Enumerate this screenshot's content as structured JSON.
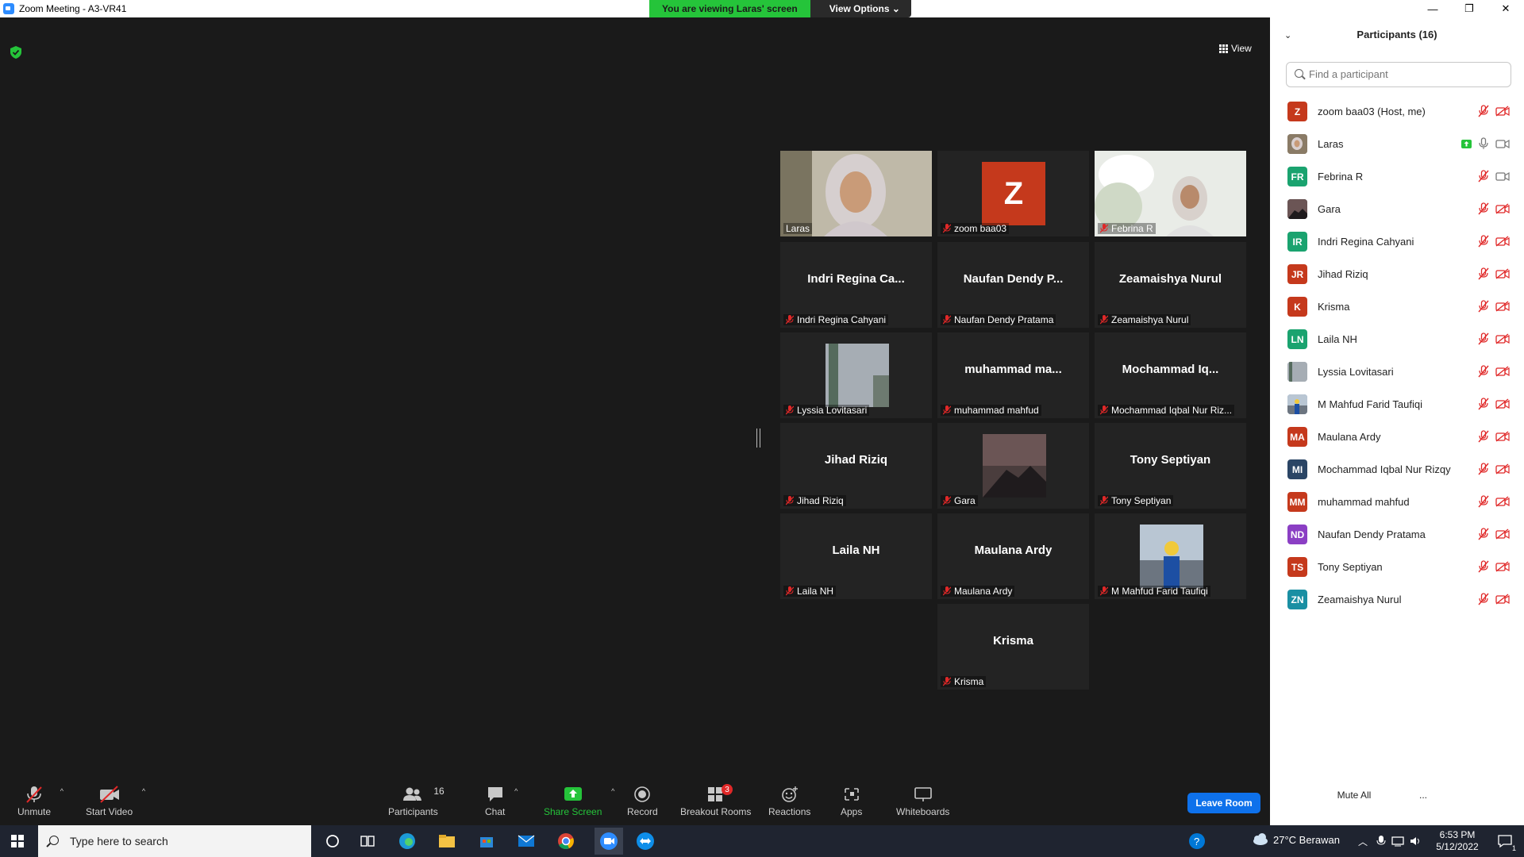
{
  "window": {
    "title": "Zoom Meeting - A3-VR41",
    "minimize": "—",
    "restore": "❐",
    "close": "✕"
  },
  "banner": {
    "viewing_text": "You are viewing Laras' screen",
    "view_options": "View Options ⌄"
  },
  "main": {
    "view_label": "View"
  },
  "tiles": [
    {
      "center": "",
      "label": "Laras"
    },
    {
      "center": "Z",
      "label": "zoom baa03"
    },
    {
      "center": "",
      "label": "Febrina R"
    },
    {
      "center": "Indri Regina Ca...",
      "label": "Indri Regina Cahyani"
    },
    {
      "center": "Naufan Dendy P...",
      "label": "Naufan Dendy Pratama"
    },
    {
      "center": "Zeamaishya Nurul",
      "label": "Zeamaishya Nurul"
    },
    {
      "center": "",
      "label": "Lyssia Lovitasari"
    },
    {
      "center": "muhammad ma...",
      "label": "muhammad mahfud"
    },
    {
      "center": "Mochammad Iq...",
      "label": "Mochammad Iqbal Nur Riz..."
    },
    {
      "center": "Jihad Riziq",
      "label": "Jihad Riziq"
    },
    {
      "center": "",
      "label": "Gara"
    },
    {
      "center": "Tony Septiyan",
      "label": "Tony Septiyan"
    },
    {
      "center": "Laila NH",
      "label": "Laila NH"
    },
    {
      "center": "Maulana Ardy",
      "label": "Maulana Ardy"
    },
    {
      "center": "",
      "label": "M Mahfud Farid Taufiqi"
    },
    {
      "center": "Krisma",
      "label": "Krisma"
    }
  ],
  "toolbar": {
    "unmute": "Unmute",
    "start_video": "Start Video",
    "participants": "Participants",
    "participants_count": "16",
    "chat": "Chat",
    "share_screen": "Share Screen",
    "record": "Record",
    "breakout_rooms": "Breakout Rooms",
    "breakout_badge": "3",
    "reactions": "Reactions",
    "apps": "Apps",
    "whiteboards": "Whiteboards",
    "leave_room": "Leave Room"
  },
  "panel": {
    "title": "Participants (16)",
    "search_placeholder": "Find a participant",
    "mute_all": "Mute All",
    "more": "...",
    "participants": [
      {
        "initials": "Z",
        "name": "zoom baa03 (Host, me)",
        "color": "#c5391c"
      },
      {
        "initials": "",
        "name": "Laras",
        "color": "#8a7b66"
      },
      {
        "initials": "FR",
        "name": "Febrina R",
        "color": "#1aa36f"
      },
      {
        "initials": "",
        "name": "Gara",
        "color": "#3b3b3b"
      },
      {
        "initials": "IR",
        "name": "Indri Regina Cahyani",
        "color": "#1aa36f"
      },
      {
        "initials": "JR",
        "name": "Jihad Riziq",
        "color": "#c5391c"
      },
      {
        "initials": "K",
        "name": "Krisma",
        "color": "#c5391c"
      },
      {
        "initials": "LN",
        "name": "Laila NH",
        "color": "#1aa36f"
      },
      {
        "initials": "",
        "name": "Lyssia Lovitasari",
        "color": "#9aa3ad"
      },
      {
        "initials": "",
        "name": "M Mahfud Farid Taufiqi",
        "color": "#4a6e9a"
      },
      {
        "initials": "MA",
        "name": "Maulana Ardy",
        "color": "#c5391c"
      },
      {
        "initials": "MI",
        "name": "Mochammad Iqbal Nur Rizqy",
        "color": "#2b4565"
      },
      {
        "initials": "MM",
        "name": "muhammad mahfud",
        "color": "#c5391c"
      },
      {
        "initials": "ND",
        "name": "Naufan Dendy Pratama",
        "color": "#8b3fc4"
      },
      {
        "initials": "TS",
        "name": "Tony Septiyan",
        "color": "#c5391c"
      },
      {
        "initials": "ZN",
        "name": "Zeamaishya Nurul",
        "color": "#1a8fa3"
      }
    ]
  },
  "taskbar": {
    "search_placeholder": "Type here to search",
    "weather": "27°C  Berawan",
    "time": "6:53 PM",
    "date": "5/12/2022",
    "notifications": "1"
  },
  "colors": {
    "mute_red": "#e02828",
    "share_green": "#25c43a",
    "leave_blue": "#0e71eb",
    "active_speaker": "#d7e84a"
  }
}
